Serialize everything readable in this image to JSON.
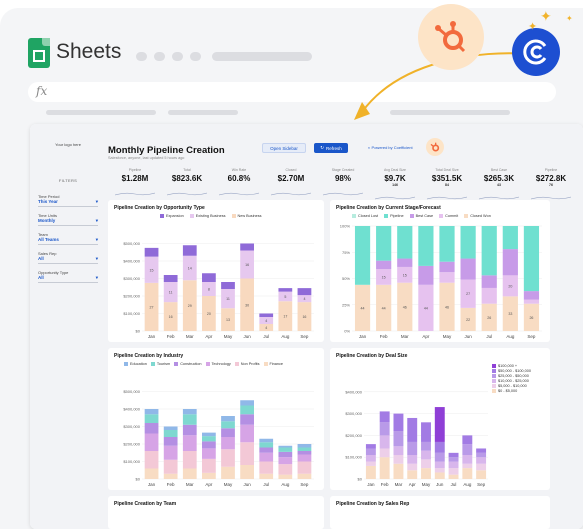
{
  "app": {
    "title": "Sheets",
    "fx": "fx"
  },
  "sidebar": {
    "logo_text": "Your logo here",
    "filters_heading": "FILTERS",
    "filters": [
      {
        "label": "Time Period",
        "value": "This Year"
      },
      {
        "label": "Time Units",
        "value": "Monthly"
      },
      {
        "label": "Team",
        "value": "All Teams"
      },
      {
        "label": "Sales Rep",
        "value": "All"
      },
      {
        "label": "Opportunity Type",
        "value": "All"
      }
    ]
  },
  "header": {
    "title": "Monthly Pipeline Creation",
    "subtitle": "Salesforce, anyone, last updated 5 hours ago",
    "open_sidebar": "Open Sidebar",
    "refresh": "Refresh",
    "powered_by": "Powered by Coefficient"
  },
  "kpis": [
    {
      "label": "Pipeline",
      "value": "$1.28M",
      "sub": ""
    },
    {
      "label": "Total",
      "value": "$823.6K",
      "sub": ""
    },
    {
      "label": "Win Rate",
      "value": "60.8%",
      "sub": ""
    },
    {
      "label": "Closed",
      "value": "$2.70M",
      "sub": ""
    },
    {
      "label": "Stage Created",
      "value": "98%",
      "sub": ""
    },
    {
      "label": "Avg Deal Size",
      "value": "$9.7K",
      "sub": "146"
    },
    {
      "label": "Total Deal Size",
      "value": "$351.5K",
      "sub": "84"
    },
    {
      "label": "Best Case",
      "value": "$265.3K",
      "sub": "43"
    },
    {
      "label": "Pipeline",
      "value": "$272.8K",
      "sub": "76"
    }
  ],
  "colors": {
    "expansion": "#8f6ad8",
    "existing": "#e6c8ef",
    "new_business": "#f8d9bf",
    "closed_lost": "#b7ecdf",
    "pipeline": "#6fe0d0",
    "best_case": "#c79be8",
    "commit": "#e6c2ef",
    "closed_won": "#f8dcc3"
  },
  "chart_data": [
    {
      "type": "bar",
      "title": "Pipeline Creation by Opportunity Type",
      "categories": [
        "Jan",
        "Feb",
        "Mar",
        "Apr",
        "May",
        "Jun",
        "Jul",
        "Aug",
        "Sep"
      ],
      "ylim": [
        0,
        600000
      ],
      "yticks": [
        "$0",
        "$100,000",
        "$200,000",
        "$300,000",
        "$400,000",
        "$500,000"
      ],
      "series": [
        {
          "name": "New Business",
          "values": [
            275000,
            165000,
            290000,
            200000,
            130000,
            300000,
            40000,
            170000,
            165000
          ],
          "labels": [
            "27",
            "16",
            "29",
            "20",
            "13",
            "30",
            "4",
            "17",
            "16"
          ]
        },
        {
          "name": "Existing Business",
          "values": [
            150000,
            115000,
            140000,
            80000,
            110000,
            160000,
            40000,
            55000,
            40000
          ],
          "labels": [
            "15",
            "11",
            "14",
            "8",
            "11",
            "16",
            "4",
            "5",
            "4"
          ]
        },
        {
          "name": "Expansion",
          "values": [
            50000,
            40000,
            60000,
            50000,
            40000,
            40000,
            20000,
            20000,
            40000
          ],
          "labels": [
            "",
            "",
            "",
            "",
            "",
            "",
            "",
            "",
            ""
          ]
        }
      ]
    },
    {
      "type": "bar",
      "title": "Pipeline Creation by Current Stage/Forecast",
      "categories": [
        "Jan",
        "Feb",
        "Mar",
        "Apr",
        "May",
        "Jun",
        "Jul",
        "Aug",
        "Sep"
      ],
      "ylim": [
        0,
        100
      ],
      "yticks": [
        "0%",
        "25%",
        "50%",
        "75%",
        "100%"
      ],
      "series": [
        {
          "name": "Closed Won",
          "values": [
            44,
            44,
            46,
            0,
            46,
            22,
            26,
            33,
            26
          ],
          "labels": [
            "44",
            "44",
            "46",
            "",
            "46",
            "22",
            "26",
            "33",
            "26"
          ]
        },
        {
          "name": "Commit",
          "values": [
            0,
            15,
            15,
            44,
            10,
            27,
            15,
            20,
            4
          ],
          "labels": [
            "",
            "15",
            "15",
            "44",
            "",
            "27",
            "",
            "20",
            ""
          ]
        },
        {
          "name": "Best Case",
          "values": [
            0,
            8,
            8,
            18,
            10,
            20,
            12,
            25,
            8
          ],
          "labels": [
            "",
            "",
            "",
            "",
            "",
            "",
            "",
            "",
            ""
          ]
        },
        {
          "name": "Pipeline",
          "values": [
            56,
            33,
            31,
            38,
            34,
            31,
            47,
            22,
            62
          ],
          "labels": [
            "",
            "",
            "",
            "",
            "",
            "",
            "",
            "",
            ""
          ]
        }
      ]
    },
    {
      "type": "bar",
      "title": "Pipeline Creation by Industry",
      "categories": [
        "Jan",
        "Feb",
        "Mar",
        "Apr",
        "May",
        "Jun",
        "Jul",
        "Aug",
        "Sep"
      ],
      "ylim": [
        0,
        600000
      ],
      "yticks": [
        "$0",
        "$100,000",
        "$200,000",
        "$300,000",
        "$400,000",
        "$500,000"
      ],
      "series": [
        {
          "name": "Finance",
          "values": [
            60000,
            30000,
            60000,
            35000,
            70000,
            80000,
            30000,
            25000,
            30000
          ],
          "labels": [
            "",
            "",
            "",
            "",
            "",
            "",
            "",
            "",
            ""
          ]
        },
        {
          "name": "Non Profits",
          "values": [
            100000,
            80000,
            100000,
            80000,
            100000,
            130000,
            70000,
            60000,
            70000
          ],
          "labels": [
            "",
            "",
            "",
            "",
            "",
            "",
            "",
            "",
            ""
          ]
        },
        {
          "name": "Technology",
          "values": [
            100000,
            80000,
            90000,
            60000,
            70000,
            100000,
            50000,
            40000,
            40000
          ],
          "labels": [
            "",
            "",
            "",
            "",
            "",
            "",
            "",
            "",
            ""
          ]
        },
        {
          "name": "Construction",
          "values": [
            60000,
            50000,
            60000,
            40000,
            50000,
            60000,
            30000,
            30000,
            20000
          ],
          "labels": [
            "",
            "",
            "",
            "",
            "",
            "",
            "",
            "",
            ""
          ]
        },
        {
          "name": "Tourism",
          "values": [
            50000,
            40000,
            60000,
            30000,
            40000,
            50000,
            30000,
            25000,
            20000
          ],
          "labels": [
            "",
            "",
            "",
            "",
            "",
            "",
            "",
            "",
            ""
          ]
        },
        {
          "name": "Education",
          "values": [
            30000,
            20000,
            30000,
            20000,
            30000,
            30000,
            20000,
            10000,
            20000
          ],
          "labels": [
            "",
            "",
            "",
            "",
            "",
            "",
            "",
            "",
            ""
          ]
        }
      ]
    },
    {
      "type": "bar",
      "title": "Pipeline Creation by Deal Size",
      "categories": [
        "Jan",
        "Feb",
        "Mar",
        "Apr",
        "May",
        "Jun",
        "Jul",
        "Aug",
        "Sep"
      ],
      "ylim": [
        0,
        500000
      ],
      "yticks": [
        "$0",
        "$100,000",
        "$200,000",
        "$300,000",
        "$400,000"
      ],
      "series": [
        {
          "name": "$0 - $5,000",
          "values": [
            60000,
            100000,
            70000,
            40000,
            50000,
            30000,
            20000,
            50000,
            40000
          ],
          "labels": [
            "",
            "",
            "",
            "",
            "",
            "",
            "",
            "",
            ""
          ]
        },
        {
          "name": "$5,000 - $10,000",
          "values": [
            20000,
            40000,
            40000,
            30000,
            40000,
            20000,
            30000,
            20000,
            30000
          ],
          "labels": [
            "",
            "",
            "",
            "",
            "",
            "",
            "",
            "",
            ""
          ]
        },
        {
          "name": "$10,000 - $25,000",
          "values": [
            30000,
            60000,
            40000,
            40000,
            40000,
            30000,
            30000,
            40000,
            30000
          ],
          "labels": [
            "",
            "",
            "",
            "",
            "",
            "",
            "",
            "",
            ""
          ]
        },
        {
          "name": "$25,000 - $50,000",
          "values": [
            30000,
            60000,
            70000,
            60000,
            40000,
            40000,
            20000,
            50000,
            20000
          ],
          "labels": [
            "",
            "",
            "",
            "",
            "",
            "",
            "",
            "",
            ""
          ]
        },
        {
          "name": "$50,000 - $100,000",
          "values": [
            20000,
            50000,
            80000,
            110000,
            90000,
            50000,
            20000,
            40000,
            20000
          ],
          "labels": [
            "",
            "",
            "",
            "",
            "",
            "",
            "",
            "",
            ""
          ]
        },
        {
          "name": "$100,000 +",
          "values": [
            0,
            0,
            0,
            0,
            0,
            160000,
            0,
            0,
            0
          ],
          "labels": [
            "",
            "",
            "",
            "",
            "",
            "",
            "",
            "",
            ""
          ]
        }
      ]
    }
  ],
  "bottom_panels": [
    "Pipeline Creation by Team",
    "Pipeline Creation by Sales Rep"
  ]
}
